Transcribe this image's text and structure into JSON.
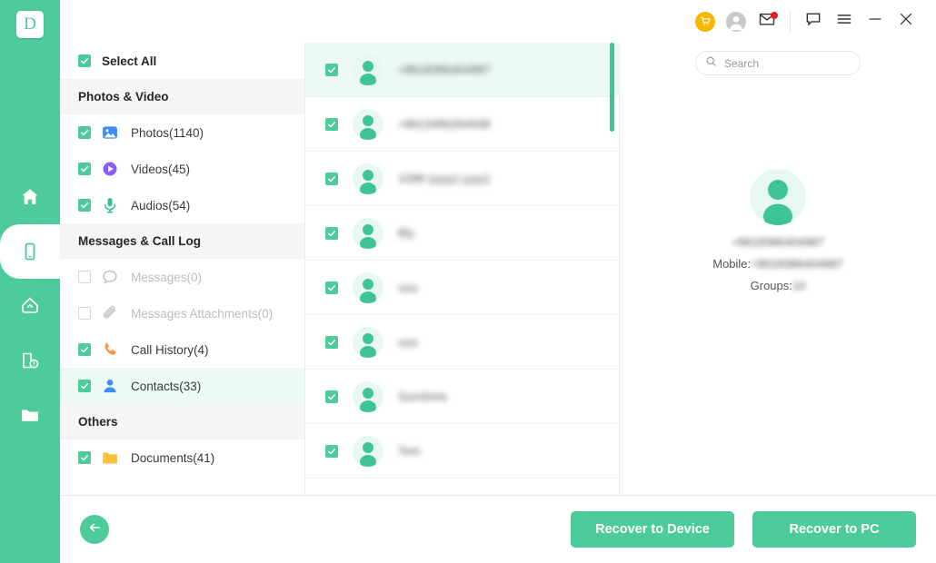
{
  "app": {
    "logo_letter": "D",
    "accent_color": "#4ECB9B",
    "highlight_color": "#edf9f4",
    "cart_color": "#F7B500",
    "badge_color": "#ED1C24"
  },
  "nav_rail": {
    "items": [
      {
        "name": "home",
        "icon": "home-icon",
        "active": false
      },
      {
        "name": "device",
        "icon": "phone-icon",
        "active": true
      },
      {
        "name": "backup",
        "icon": "cloud-upload-icon",
        "active": false
      },
      {
        "name": "repair",
        "icon": "device-repair-icon",
        "active": false
      },
      {
        "name": "files",
        "icon": "folder-icon",
        "active": false
      }
    ]
  },
  "titlebar": {
    "buttons": [
      {
        "name": "cart-button",
        "icon": "shopping-cart-icon"
      },
      {
        "name": "account-button",
        "icon": "user-avatar-icon"
      },
      {
        "name": "mail-button",
        "icon": "mail-icon",
        "badge": true
      },
      {
        "name": "feedback-button",
        "icon": "chat-bubble-icon"
      },
      {
        "name": "menu-button",
        "icon": "hamburger-menu-icon"
      },
      {
        "name": "minimize-button",
        "icon": "minimize-icon"
      },
      {
        "name": "close-button",
        "icon": "close-icon"
      }
    ]
  },
  "sidebar": {
    "select_all_label": "Select All",
    "select_all_checked": true,
    "groups": [
      {
        "header": "Photos & Video",
        "items": [
          {
            "label": "Photos(1140)",
            "icon": "photo-icon",
            "checked": true,
            "enabled": true,
            "selected": false
          },
          {
            "label": "Videos(45)",
            "icon": "video-icon",
            "checked": true,
            "enabled": true,
            "selected": false
          },
          {
            "label": "Audios(54)",
            "icon": "audio-icon",
            "checked": true,
            "enabled": true,
            "selected": false
          }
        ]
      },
      {
        "header": "Messages & Call Log",
        "items": [
          {
            "label": "Messages(0)",
            "icon": "message-icon",
            "checked": false,
            "enabled": false,
            "selected": false
          },
          {
            "label": "Messages Attachments(0)",
            "icon": "attachment-icon",
            "checked": false,
            "enabled": false,
            "selected": false
          },
          {
            "label": "Call History(4)",
            "icon": "call-icon",
            "checked": true,
            "enabled": true,
            "selected": false
          },
          {
            "label": "Contacts(33)",
            "icon": "contacts-icon",
            "checked": true,
            "enabled": true,
            "selected": true
          }
        ]
      },
      {
        "header": "Others",
        "items": [
          {
            "label": "Documents(41)",
            "icon": "document-folder-icon",
            "checked": true,
            "enabled": true,
            "selected": false
          }
        ]
      }
    ]
  },
  "search": {
    "placeholder": "Search",
    "value": "",
    "icon": "search-icon"
  },
  "contact_list": {
    "scroll_thumb_top_pct": 0,
    "rows": [
      {
        "name": "+8618386404987",
        "checked": true,
        "active": true,
        "redacted": true
      },
      {
        "name": "+8613486264938",
        "checked": true,
        "active": false,
        "redacted": true
      },
      {
        "name": "1088 (yyyy) yyyy)",
        "checked": true,
        "active": false,
        "redacted": true
      },
      {
        "name": "Bly",
        "checked": true,
        "active": false,
        "redacted": true
      },
      {
        "name": "uuu",
        "checked": true,
        "active": false,
        "redacted": true
      },
      {
        "name": "uuu",
        "checked": true,
        "active": false,
        "redacted": true
      },
      {
        "name": "Sunshine",
        "checked": true,
        "active": false,
        "redacted": true
      },
      {
        "name": "Tom",
        "checked": true,
        "active": false,
        "redacted": true
      }
    ]
  },
  "contact_detail": {
    "avatar_icon": "person-avatar-icon",
    "display_name": "+8618386404987",
    "mobile_label": "Mobile: ",
    "mobile_value": "+8618386404987",
    "groups_label": "Groups: ",
    "groups_value": "10"
  },
  "bottombar": {
    "back_icon": "arrow-left-icon",
    "recover_to_device_label": "Recover to Device",
    "recover_to_pc_label": "Recover to PC"
  }
}
